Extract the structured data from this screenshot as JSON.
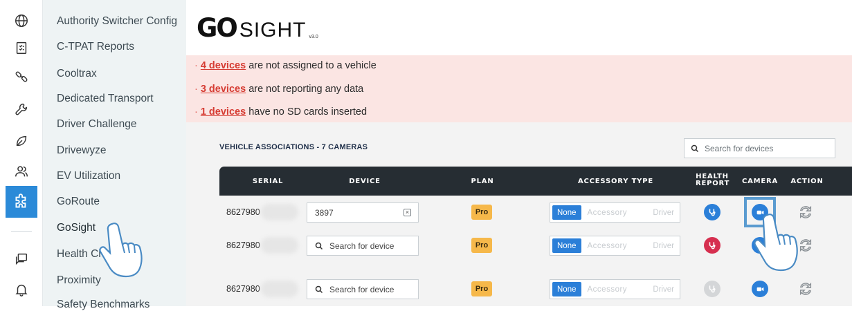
{
  "rail": {
    "items": [
      {
        "icon": "globe-icon",
        "active": false
      },
      {
        "icon": "clipboard-icon",
        "active": false
      },
      {
        "icon": "link-icon",
        "active": false
      },
      {
        "icon": "wrench-icon",
        "active": false
      },
      {
        "icon": "leaf-icon",
        "active": false
      },
      {
        "icon": "users-icon",
        "active": false
      },
      {
        "icon": "puzzle-icon",
        "active": true
      },
      {
        "icon": "chat-icon",
        "active": false
      },
      {
        "icon": "bell-icon",
        "active": false
      }
    ],
    "active_color": "#2b8ad8"
  },
  "menu": {
    "items": [
      "Authority Switcher Config",
      "C-TPAT Reports",
      "Cooltrax",
      "Dedicated Transport",
      "Driver Challenge",
      "Drivewyze",
      "EV Utilization",
      "GoRoute",
      "GoSight",
      "Health Check",
      "Proximity",
      "Safety Benchmarks"
    ],
    "active": "GoSight"
  },
  "logo": {
    "go": "GO",
    "sight": "SIGHT",
    "version": "v3.0"
  },
  "alerts": [
    {
      "link": "4 devices",
      "text": "are not assigned to a vehicle"
    },
    {
      "link": "3 devices",
      "text": "are not reporting any data"
    },
    {
      "link": "1 devices",
      "text": "have no SD cards inserted"
    }
  ],
  "section": {
    "title": "VEHICLE ASSOCIATIONS - 7 CAMERAS",
    "search_placeholder": "Search for devices"
  },
  "table": {
    "columns": {
      "serial": "SERIAL",
      "device": "DEVICE",
      "plan": "PLAN",
      "accessory": "ACCESSORY TYPE",
      "health_1": "HEALTH",
      "health_2": "REPORT",
      "camera": "CAMERA",
      "action": "ACTION"
    },
    "accessory_options": [
      "None",
      "Accessory",
      "Driver"
    ],
    "rows": [
      {
        "serial": "8627980",
        "device_value": "3897",
        "device_placeholder": "",
        "plan": "Pro",
        "accessory": "None",
        "health_status": "ok",
        "health_color": "#2b7fd8"
      },
      {
        "serial": "8627980",
        "device_value": "",
        "device_placeholder": "Search for device",
        "plan": "Pro",
        "accessory": "None",
        "health_status": "error",
        "health_color": "#d62f4f"
      },
      {
        "serial": "8627980",
        "device_value": "",
        "device_placeholder": "Search for device",
        "plan": "Pro",
        "accessory": "None",
        "health_status": "unknown",
        "health_color": "#d4d6d8"
      }
    ]
  },
  "colors": {
    "alert_bg": "#fbe5e3",
    "alert_link": "#d63c33",
    "table_header": "#262d33",
    "plan_badge": "#f6b84a",
    "primary": "#2b7fd8"
  }
}
